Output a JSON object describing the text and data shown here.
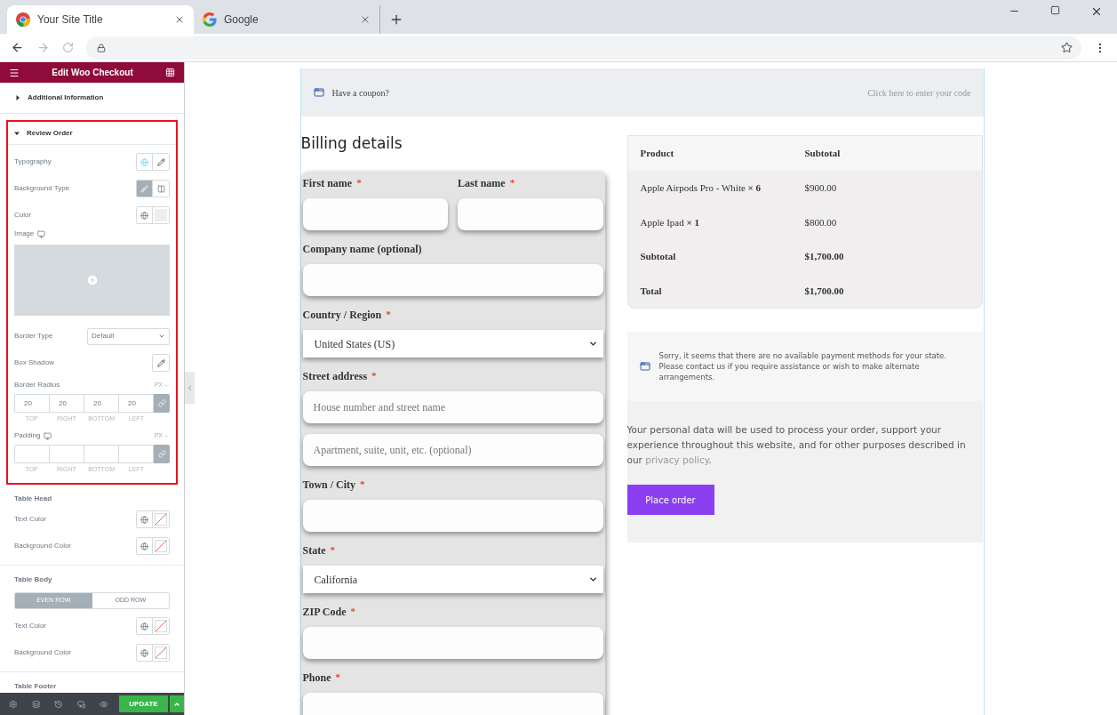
{
  "browser": {
    "tabs": [
      {
        "title": "Your Site Title",
        "selected": true
      },
      {
        "title": "Google",
        "selected": false
      }
    ]
  },
  "editor": {
    "title": "Edit Woo Checkout",
    "sections": [
      {
        "title": "Additional Information",
        "kind": "accordion",
        "expanded": false
      },
      {
        "title": "Review Order",
        "kind": "accordion",
        "expanded": true,
        "highlighted": true,
        "controls": [
          {
            "kind": "typography",
            "label": "Typography"
          },
          {
            "kind": "toggle",
            "label": "Background Type",
            "options": [
              {
                "selected": true
              },
              {
                "selected": false
              }
            ]
          },
          {
            "kind": "color",
            "label": "Color",
            "empty": false
          },
          {
            "kind": "image",
            "label": "Image",
            "responsive": true
          },
          {
            "kind": "select",
            "label": "Border Type",
            "value": "Default"
          },
          {
            "kind": "edit",
            "label": "Box Shadow"
          },
          {
            "kind": "dimensions",
            "label": "Border Radius",
            "unit": "PX",
            "values": [
              "20",
              "20",
              "20",
              "20"
            ],
            "sides": [
              "TOP",
              "RIGHT",
              "BOTTOM",
              "LEFT"
            ],
            "linked": true
          },
          {
            "kind": "dimensions",
            "label": "Padding",
            "unit": "PX",
            "sides": [
              "TOP",
              "RIGHT",
              "BOTTOM",
              "LEFT"
            ],
            "linked": true,
            "responsive": true
          }
        ]
      },
      {
        "title": "Table Head",
        "kind": "heading",
        "controls": [
          {
            "kind": "color",
            "label": "Text Color",
            "empty": true
          },
          {
            "kind": "color",
            "label": "Background Color",
            "empty": true
          }
        ]
      },
      {
        "title": "Table Body",
        "kind": "heading",
        "controls": [
          {
            "kind": "row_tabs",
            "tabs": [
              {
                "label": "EVEN ROW",
                "selected": true
              },
              {
                "label": "ODD ROW",
                "selected": false
              }
            ]
          },
          {
            "kind": "color",
            "label": "Text Color",
            "empty": true
          },
          {
            "kind": "color",
            "label": "Background Color",
            "empty": true
          }
        ]
      },
      {
        "title": "Table Footer",
        "kind": "heading"
      }
    ],
    "update": "UPDATE"
  },
  "page": {
    "coupon": {
      "text": "Have a coupon?",
      "link": "Click here to enter your code"
    },
    "billing": {
      "title": "Billing details",
      "fields": [
        {
          "kind": "pair",
          "fields": [
            {
              "kind": "input",
              "label": "First name",
              "required_mark": "*"
            },
            {
              "kind": "input",
              "label": "Last name",
              "required_mark": "*"
            }
          ]
        },
        {
          "kind": "input",
          "label": "Company name (optional)"
        },
        {
          "kind": "select",
          "label": "Country / Region",
          "required_mark": "*",
          "value": "United States (US)"
        },
        {
          "kind": "input",
          "label": "Street address",
          "required_mark": "*",
          "placeholder": "House number and street name"
        },
        {
          "kind": "input",
          "placeholder": "Apartment, suite, unit, etc. (optional)"
        },
        {
          "kind": "input",
          "label": "Town / City",
          "required_mark": "*"
        },
        {
          "kind": "select",
          "label": "State",
          "required_mark": "*",
          "value": "California"
        },
        {
          "kind": "input",
          "label": "ZIP Code",
          "required_mark": "*"
        },
        {
          "kind": "input",
          "label": "Phone",
          "required_mark": "*"
        }
      ]
    },
    "order": {
      "columns": [
        "Product",
        "Subtotal"
      ],
      "rows": [
        {
          "kind": "item",
          "cells": [
            "Apple Airpods Pro - White  **× 6**",
            "$900.00"
          ]
        },
        {
          "kind": "item",
          "cells": [
            "Apple Ipad  **× 1**",
            "$800.00"
          ]
        },
        {
          "kind": "total",
          "cells": [
            "Subtotal",
            "$1,700.00"
          ]
        },
        {
          "kind": "total",
          "cells": [
            "Total",
            "$1,700.00"
          ]
        }
      ]
    },
    "payment_notice": "Sorry, it seems that there are no available payment methods for your state. Please contact us if you require assistance or wish to make alternate arrangements.",
    "privacy": {
      "before": "Your personal data will be used to process your order, support your experience throughout this website, and for other purposes described in our ",
      "link": "privacy policy",
      "after": "."
    },
    "place_order": "Place order"
  }
}
